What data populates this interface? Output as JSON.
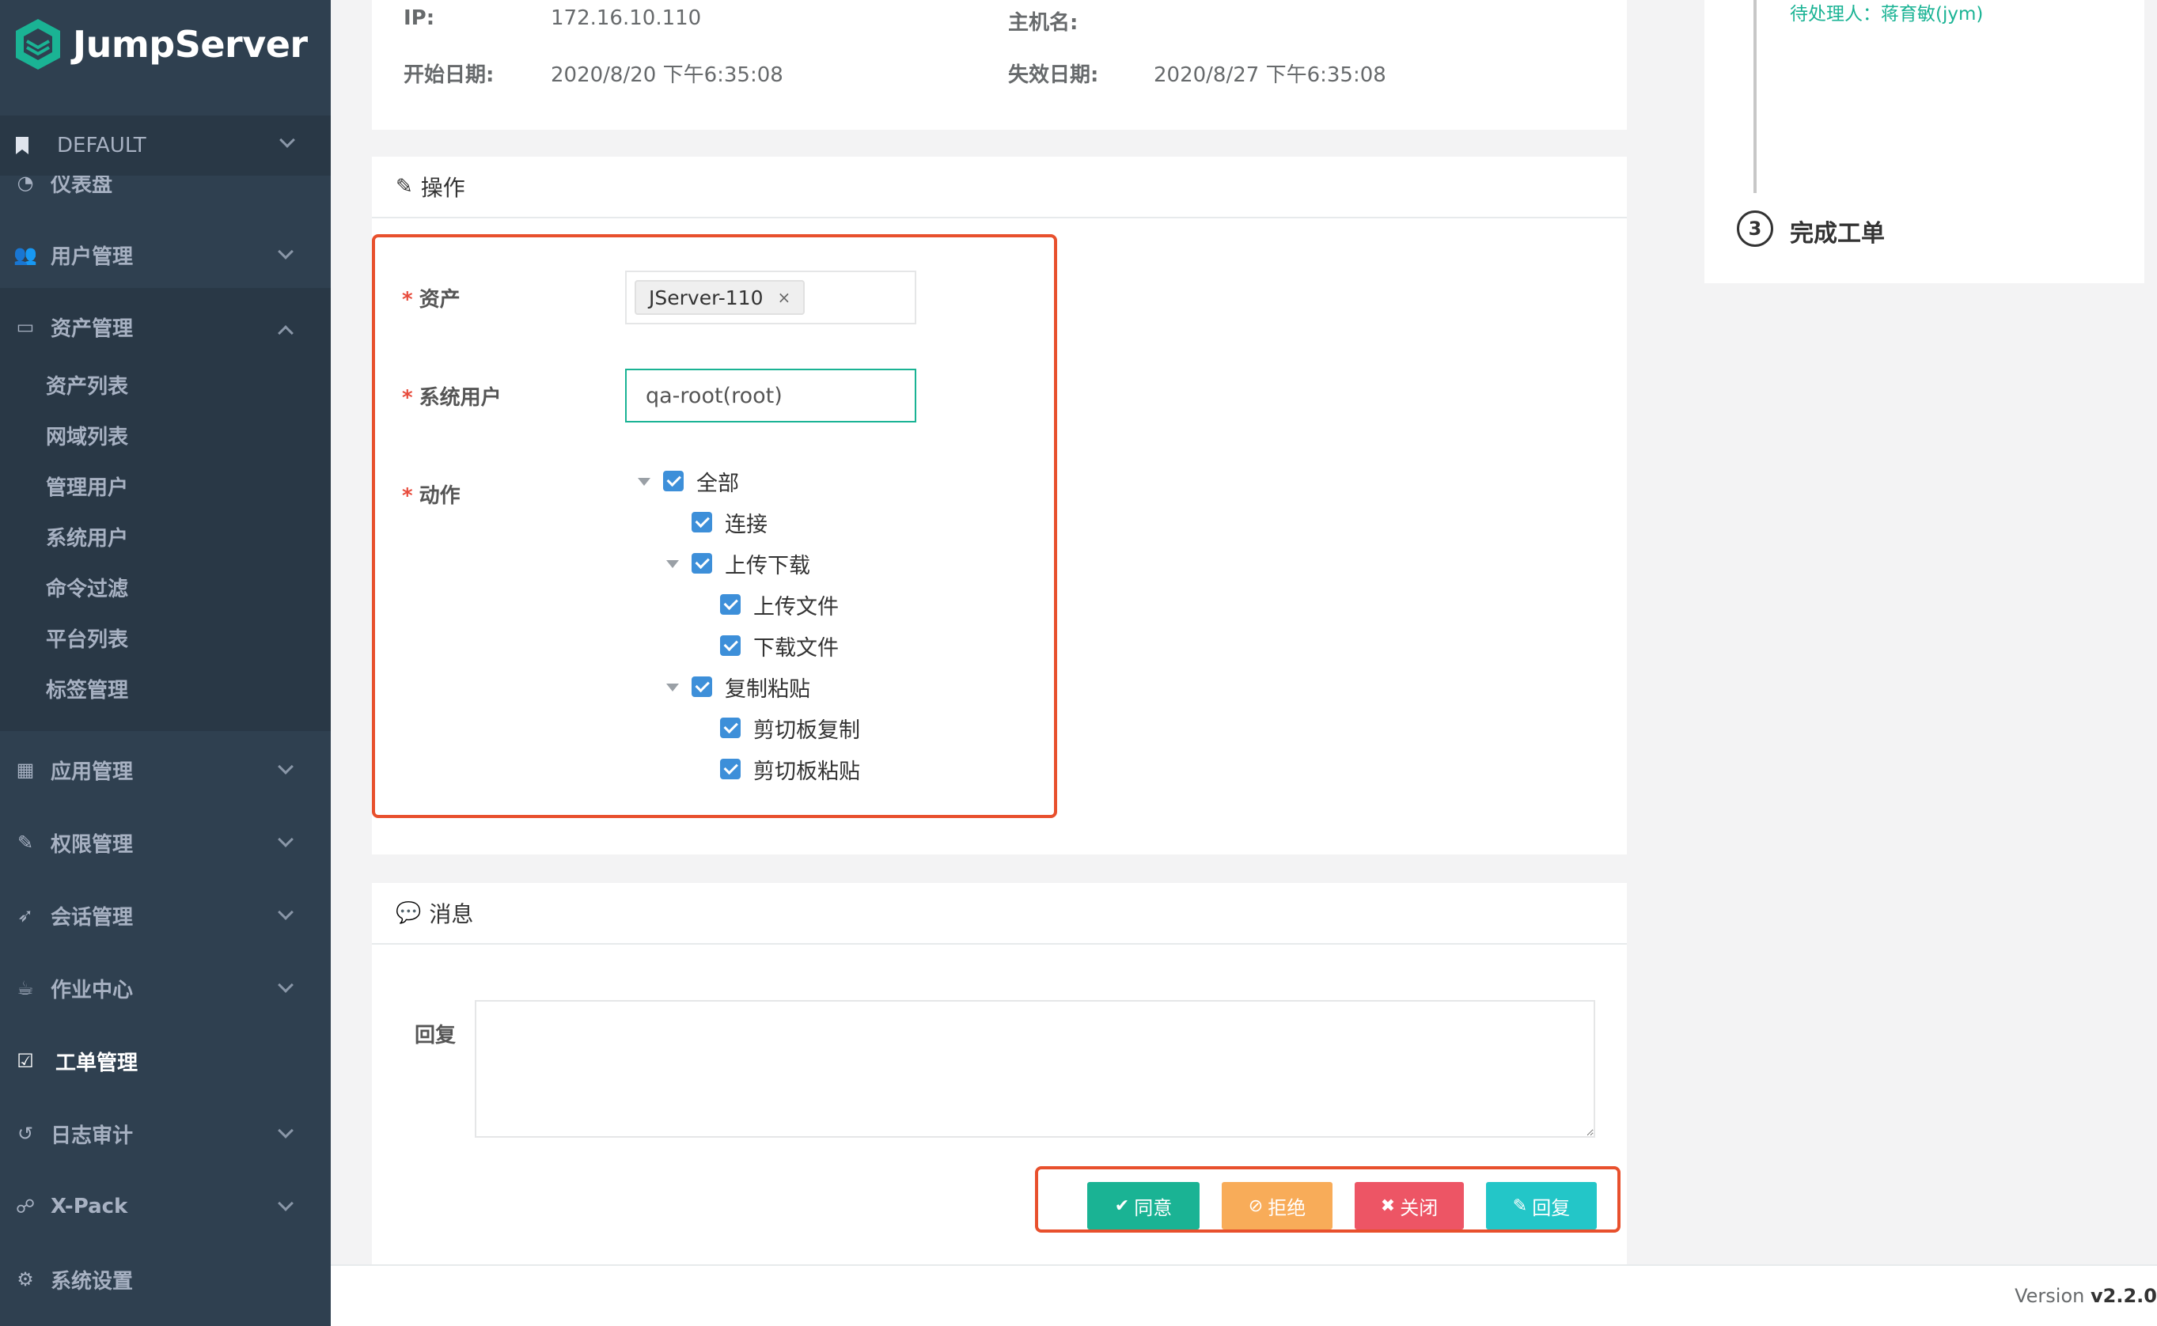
{
  "brand": {
    "name": "JumpServer",
    "accent": "#1ab394",
    "sidebar_bg": "#2f4050"
  },
  "org": {
    "name": "DEFAULT"
  },
  "nav": {
    "dashboard": "仪表盘",
    "users": "用户管理",
    "assets": "资产管理",
    "asset_sub": [
      "资产列表",
      "网域列表",
      "管理用户",
      "系统用户",
      "命令过滤",
      "平台列表",
      "标签管理"
    ],
    "apps": "应用管理",
    "perms": "权限管理",
    "sessions": "会话管理",
    "ops": "作业中心",
    "tickets": "工单管理",
    "audits": "日志审计",
    "xpack": "X-Pack",
    "settings": "系统设置"
  },
  "ticket_info": {
    "ip_label": "IP:",
    "ip_value": "172.16.10.110",
    "hostname_label": "主机名:",
    "hostname_value": "",
    "start_label": "开始日期:",
    "start_value": "2020/8/20 下午6:35:08",
    "expire_label": "失效日期:",
    "expire_value": "2020/8/27 下午6:35:08"
  },
  "operation": {
    "title": "操作",
    "asset_label": "资产",
    "asset_tag": "JServer-110",
    "sysuser_label": "系统用户",
    "sysuser_value": "qa-root(root)",
    "action_label": "动作",
    "tree": {
      "all": "全部",
      "connect": "连接",
      "updown": "上传下载",
      "upload": "上传文件",
      "download": "下载文件",
      "clipboard": "复制粘贴",
      "copy": "剪切板复制",
      "paste": "剪切板粘贴"
    }
  },
  "message": {
    "title": "消息",
    "reply_label": "回复",
    "reply_value": ""
  },
  "buttons": {
    "approve": "同意",
    "reject": "拒绝",
    "close": "关闭",
    "reply": "回复",
    "colors": {
      "approve": "#1ab394",
      "reject": "#f8ac59",
      "close": "#ed5565",
      "reply": "#23c6c8"
    }
  },
  "timeline": {
    "pending": "待处理人：蒋育敏(jym)",
    "step_number": "3",
    "step_title": "完成工单"
  },
  "footer": {
    "version_label": "Version",
    "version_value": "v2.2.0"
  }
}
